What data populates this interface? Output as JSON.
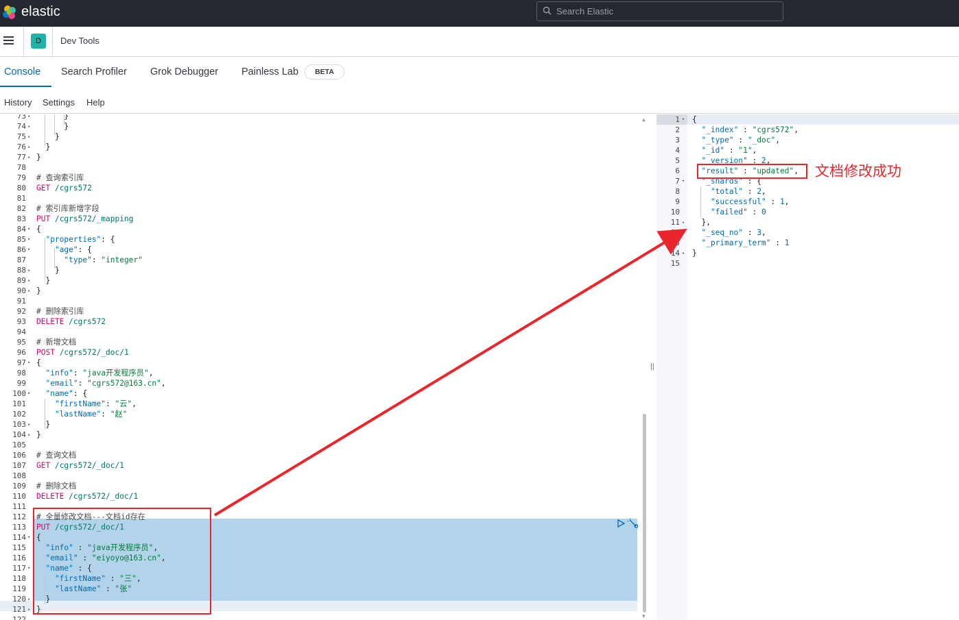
{
  "topbar": {
    "brand": "elastic",
    "search_placeholder": "Search Elastic"
  },
  "header": {
    "space_initial": "D",
    "breadcrumb": "Dev Tools"
  },
  "tabs": [
    {
      "label": "Console",
      "active": true
    },
    {
      "label": "Search Profiler"
    },
    {
      "label": "Grok Debugger"
    },
    {
      "label": "Painless Lab"
    }
  ],
  "beta_badge": "BETA",
  "subnav": [
    "History",
    "Settings",
    "Help"
  ],
  "editor": {
    "lines": [
      {
        "n": "73",
        "fold": "▴",
        "tokens": [
          [
            "c-punc",
            "      }"
          ]
        ]
      },
      {
        "n": "74",
        "fold": "▴",
        "tokens": [
          [
            "c-punc",
            "      }"
          ]
        ]
      },
      {
        "n": "75",
        "fold": "▴",
        "tokens": [
          [
            "c-punc",
            "    }"
          ]
        ]
      },
      {
        "n": "76",
        "fold": "▴",
        "tokens": [
          [
            "c-punc",
            "  }"
          ]
        ]
      },
      {
        "n": "77",
        "fold": "▴",
        "tokens": [
          [
            "c-punc",
            "}"
          ]
        ]
      },
      {
        "n": "78",
        "fold": "",
        "tokens": []
      },
      {
        "n": "79",
        "fold": "",
        "tokens": [
          [
            "c-comment",
            "# 查询索引库"
          ]
        ]
      },
      {
        "n": "80",
        "fold": "",
        "tokens": [
          [
            "c-method",
            "GET"
          ],
          [
            "c-url",
            " /cgrs572"
          ]
        ]
      },
      {
        "n": "81",
        "fold": "",
        "tokens": []
      },
      {
        "n": "82",
        "fold": "",
        "tokens": [
          [
            "c-comment",
            "# 索引库新增字段"
          ]
        ]
      },
      {
        "n": "83",
        "fold": "",
        "tokens": [
          [
            "c-method",
            "PUT"
          ],
          [
            "c-url",
            " /cgrs572/_mapping"
          ]
        ]
      },
      {
        "n": "84",
        "fold": "▾",
        "tokens": [
          [
            "c-punc",
            "{"
          ]
        ]
      },
      {
        "n": "85",
        "fold": "▾",
        "tokens": [
          [
            "c-key",
            "  \"properties\""
          ],
          [
            "c-punc",
            ": {"
          ]
        ]
      },
      {
        "n": "86",
        "fold": "▾",
        "tokens": [
          [
            "c-key",
            "    \"age\""
          ],
          [
            "c-punc",
            ": {"
          ]
        ]
      },
      {
        "n": "87",
        "fold": "",
        "tokens": [
          [
            "c-key",
            "      \"type\""
          ],
          [
            "c-punc",
            ": "
          ],
          [
            "c-str",
            "\"integer\""
          ]
        ]
      },
      {
        "n": "88",
        "fold": "▴",
        "tokens": [
          [
            "c-punc",
            "    }"
          ]
        ]
      },
      {
        "n": "89",
        "fold": "▴",
        "tokens": [
          [
            "c-punc",
            "  }"
          ]
        ]
      },
      {
        "n": "90",
        "fold": "▴",
        "tokens": [
          [
            "c-punc",
            "}"
          ]
        ]
      },
      {
        "n": "91",
        "fold": "",
        "tokens": []
      },
      {
        "n": "92",
        "fold": "",
        "tokens": [
          [
            "c-comment",
            "# 删除索引库"
          ]
        ]
      },
      {
        "n": "93",
        "fold": "",
        "tokens": [
          [
            "c-method",
            "DELETE"
          ],
          [
            "c-url",
            " /cgrs572"
          ]
        ]
      },
      {
        "n": "94",
        "fold": "",
        "tokens": []
      },
      {
        "n": "95",
        "fold": "",
        "tokens": [
          [
            "c-comment",
            "# 新增文档"
          ]
        ]
      },
      {
        "n": "96",
        "fold": "",
        "tokens": [
          [
            "c-method",
            "POST"
          ],
          [
            "c-url",
            " /cgrs572/_doc/1"
          ]
        ]
      },
      {
        "n": "97",
        "fold": "▾",
        "tokens": [
          [
            "c-punc",
            "{"
          ]
        ]
      },
      {
        "n": "98",
        "fold": "",
        "tokens": [
          [
            "c-key",
            "  \"info\""
          ],
          [
            "c-punc",
            ": "
          ],
          [
            "c-str",
            "\"java开发程序员\""
          ],
          [
            "c-punc",
            ","
          ]
        ]
      },
      {
        "n": "99",
        "fold": "",
        "tokens": [
          [
            "c-key",
            "  \"email\""
          ],
          [
            "c-punc",
            ": "
          ],
          [
            "c-str",
            "\"cgrs572@163.cn\""
          ],
          [
            "c-punc",
            ","
          ]
        ]
      },
      {
        "n": "100",
        "fold": "▾",
        "tokens": [
          [
            "c-key",
            "  \"name\""
          ],
          [
            "c-punc",
            ": {"
          ]
        ]
      },
      {
        "n": "101",
        "fold": "",
        "tokens": [
          [
            "c-key",
            "    \"firstName\""
          ],
          [
            "c-punc",
            ": "
          ],
          [
            "c-str",
            "\"云\""
          ],
          [
            "c-punc",
            ","
          ]
        ]
      },
      {
        "n": "102",
        "fold": "",
        "tokens": [
          [
            "c-key",
            "    \"lastName\""
          ],
          [
            "c-punc",
            ": "
          ],
          [
            "c-str",
            "\"赵\""
          ]
        ]
      },
      {
        "n": "103",
        "fold": "▴",
        "tokens": [
          [
            "c-punc",
            "  }"
          ]
        ]
      },
      {
        "n": "104",
        "fold": "▴",
        "tokens": [
          [
            "c-punc",
            "}"
          ]
        ]
      },
      {
        "n": "105",
        "fold": "",
        "tokens": []
      },
      {
        "n": "106",
        "fold": "",
        "tokens": [
          [
            "c-comment",
            "# 查询文档"
          ]
        ]
      },
      {
        "n": "107",
        "fold": "",
        "tokens": [
          [
            "c-method",
            "GET"
          ],
          [
            "c-url",
            " /cgrs572/_doc/1"
          ]
        ]
      },
      {
        "n": "108",
        "fold": "",
        "tokens": []
      },
      {
        "n": "109",
        "fold": "",
        "tokens": [
          [
            "c-comment",
            "# 删除文档"
          ]
        ]
      },
      {
        "n": "110",
        "fold": "",
        "tokens": [
          [
            "c-method",
            "DELETE"
          ],
          [
            "c-url",
            " /cgrs572/_doc/1"
          ]
        ]
      },
      {
        "n": "111",
        "fold": "",
        "tokens": []
      },
      {
        "n": "112",
        "fold": "",
        "tokens": [
          [
            "c-comment",
            "# 全量修改文档---文档id存在"
          ]
        ]
      },
      {
        "n": "113",
        "fold": "",
        "tokens": [
          [
            "c-method",
            "PUT"
          ],
          [
            "c-url",
            " /cgrs572/_doc/1"
          ]
        ]
      },
      {
        "n": "114",
        "fold": "▾",
        "tokens": [
          [
            "c-punc",
            "{"
          ]
        ]
      },
      {
        "n": "115",
        "fold": "",
        "tokens": [
          [
            "c-key",
            "  \"info\""
          ],
          [
            "c-punc",
            " : "
          ],
          [
            "c-str",
            "\"java开发程序员\""
          ],
          [
            "c-punc",
            ","
          ]
        ]
      },
      {
        "n": "116",
        "fold": "",
        "tokens": [
          [
            "c-key",
            "  \"email\""
          ],
          [
            "c-punc",
            " : "
          ],
          [
            "c-str",
            "\"eiyoyo@163.cn\""
          ],
          [
            "c-punc",
            ","
          ]
        ]
      },
      {
        "n": "117",
        "fold": "▾",
        "tokens": [
          [
            "c-key",
            "  \"name\""
          ],
          [
            "c-punc",
            " : {"
          ]
        ]
      },
      {
        "n": "118",
        "fold": "",
        "tokens": [
          [
            "c-key",
            "    \"firstName\""
          ],
          [
            "c-punc",
            " : "
          ],
          [
            "c-str",
            "\"三\""
          ],
          [
            "c-punc",
            ","
          ]
        ]
      },
      {
        "n": "119",
        "fold": "",
        "tokens": [
          [
            "c-key",
            "    \"lastName\""
          ],
          [
            "c-punc",
            " : "
          ],
          [
            "c-str",
            "\"张\""
          ]
        ]
      },
      {
        "n": "120",
        "fold": "▴",
        "tokens": [
          [
            "c-punc",
            "  }"
          ]
        ]
      },
      {
        "n": "121",
        "fold": "▴",
        "tokens": [
          [
            "c-punc",
            "}"
          ]
        ]
      },
      {
        "n": "122",
        "fold": "",
        "tokens": []
      }
    ]
  },
  "output": {
    "lines": [
      {
        "n": "1",
        "fold": "▾",
        "tokens": [
          [
            "c-punc",
            "{"
          ]
        ]
      },
      {
        "n": "2",
        "fold": "",
        "tokens": [
          [
            "o-key",
            "  \"_index\""
          ],
          [
            "c-punc",
            " : "
          ],
          [
            "o-str",
            "\"cgrs572\""
          ],
          [
            "c-punc",
            ","
          ]
        ]
      },
      {
        "n": "3",
        "fold": "",
        "tokens": [
          [
            "o-key",
            "  \"_type\""
          ],
          [
            "c-punc",
            " : "
          ],
          [
            "o-str",
            "\"_doc\""
          ],
          [
            "c-punc",
            ","
          ]
        ]
      },
      {
        "n": "4",
        "fold": "",
        "tokens": [
          [
            "o-key",
            "  \"_id\""
          ],
          [
            "c-punc",
            " : "
          ],
          [
            "o-str",
            "\"1\""
          ],
          [
            "c-punc",
            ","
          ]
        ]
      },
      {
        "n": "5",
        "fold": "",
        "tokens": [
          [
            "o-key",
            "  \"_version\""
          ],
          [
            "c-punc",
            " : "
          ],
          [
            "o-num",
            "2"
          ],
          [
            "c-punc",
            ","
          ]
        ]
      },
      {
        "n": "6",
        "fold": "",
        "tokens": [
          [
            "o-key",
            "  \"result\""
          ],
          [
            "c-punc",
            " : "
          ],
          [
            "o-str",
            "\"updated\""
          ],
          [
            "c-punc",
            ","
          ]
        ]
      },
      {
        "n": "7",
        "fold": "▾",
        "tokens": [
          [
            "o-key",
            "  \"_shards\""
          ],
          [
            "c-punc",
            " : {"
          ]
        ]
      },
      {
        "n": "8",
        "fold": "",
        "tokens": [
          [
            "o-key",
            "    \"total\""
          ],
          [
            "c-punc",
            " : "
          ],
          [
            "o-num",
            "2"
          ],
          [
            "c-punc",
            ","
          ]
        ]
      },
      {
        "n": "9",
        "fold": "",
        "tokens": [
          [
            "o-key",
            "    \"successful\""
          ],
          [
            "c-punc",
            " : "
          ],
          [
            "o-num",
            "1"
          ],
          [
            "c-punc",
            ","
          ]
        ]
      },
      {
        "n": "10",
        "fold": "",
        "tokens": [
          [
            "o-key",
            "    \"failed\""
          ],
          [
            "c-punc",
            " : "
          ],
          [
            "o-num",
            "0"
          ]
        ]
      },
      {
        "n": "11",
        "fold": "▴",
        "tokens": [
          [
            "c-punc",
            "  },"
          ]
        ]
      },
      {
        "n": "12",
        "fold": "",
        "tokens": [
          [
            "o-key",
            "  \"_seq_no\""
          ],
          [
            "c-punc",
            " : "
          ],
          [
            "o-num",
            "3"
          ],
          [
            "c-punc",
            ","
          ]
        ]
      },
      {
        "n": "13",
        "fold": "",
        "tokens": [
          [
            "o-key",
            "  \"_primary_term\""
          ],
          [
            "c-punc",
            " : "
          ],
          [
            "o-num",
            "1"
          ]
        ]
      },
      {
        "n": "14",
        "fold": "▴",
        "tokens": [
          [
            "c-punc",
            "}"
          ]
        ]
      },
      {
        "n": "15",
        "fold": "",
        "tokens": []
      }
    ]
  },
  "annotation": {
    "label": "文档修改成功",
    "color": "#e8262b"
  },
  "colors": {
    "accent": "#006bb4",
    "topbar": "#25282f",
    "space": "#20b2aa"
  }
}
